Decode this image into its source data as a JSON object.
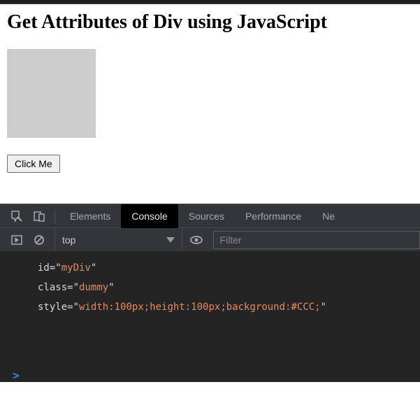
{
  "page": {
    "title": "Get Attributes of Div using JavaScript",
    "button_label": "Click Me"
  },
  "devtools": {
    "tabs": {
      "elements": "Elements",
      "console": "Console",
      "sources": "Sources",
      "performance": "Performance",
      "network": "Ne"
    },
    "context": "top",
    "filter_placeholder": "Filter",
    "output": [
      {
        "name": "id",
        "value": "myDiv"
      },
      {
        "name": "class",
        "value": "dummy"
      },
      {
        "name": "style",
        "value": "width:100px;height:100px;background:#CCC;"
      }
    ],
    "prompt": ">"
  }
}
